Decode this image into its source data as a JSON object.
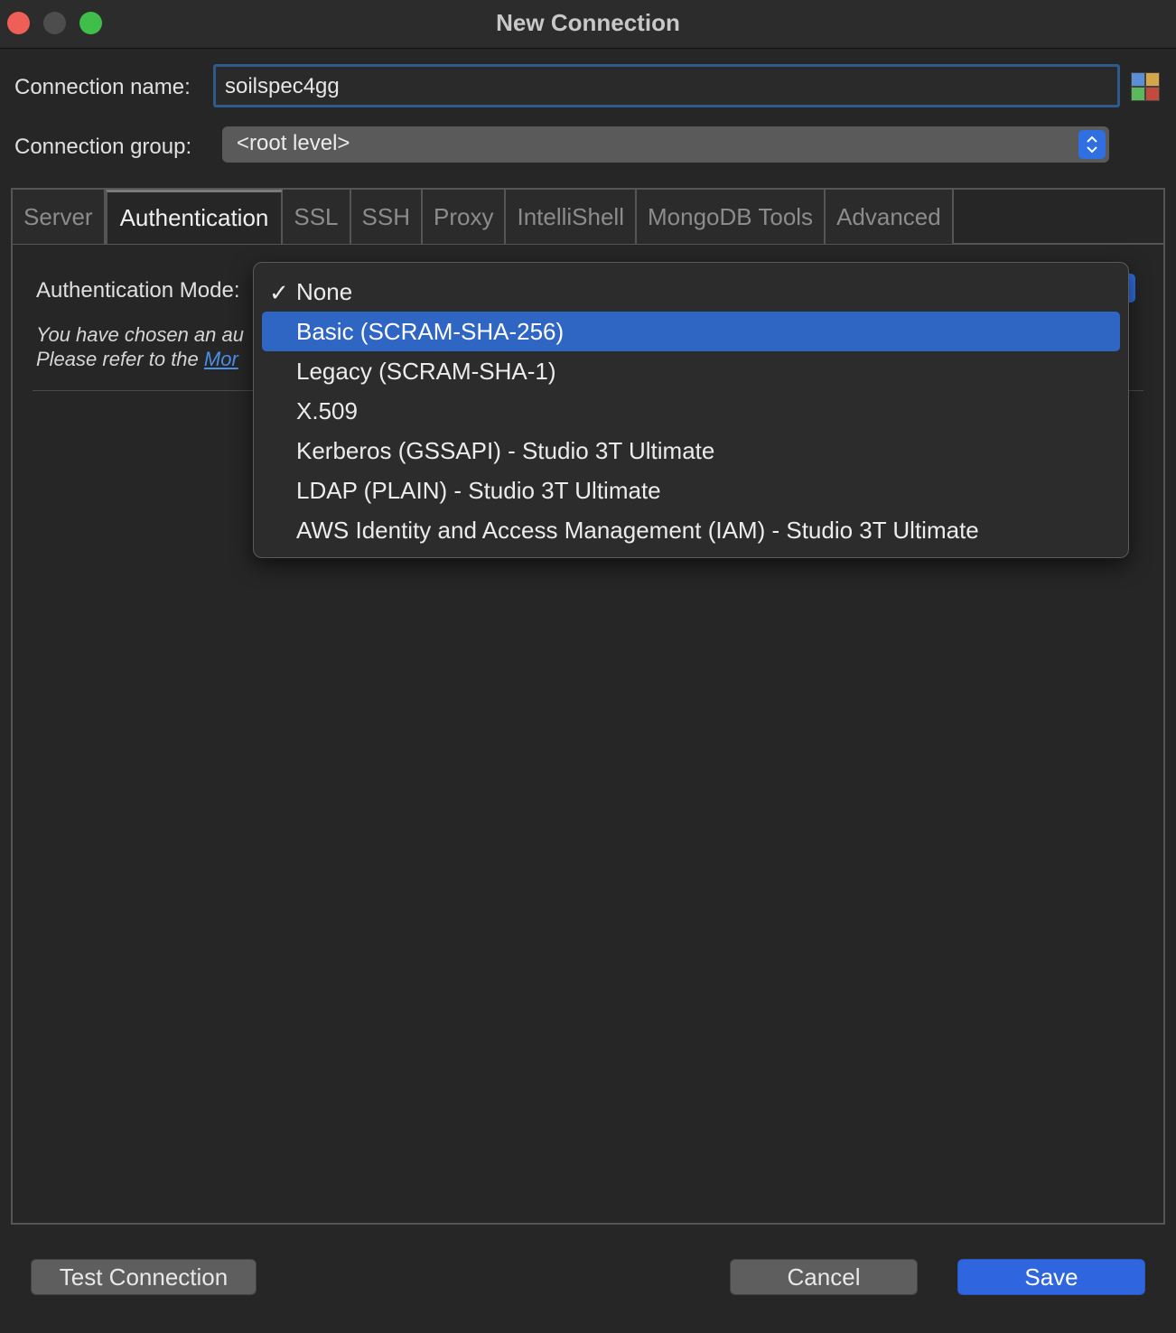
{
  "window": {
    "title": "New Connection"
  },
  "form": {
    "connection_name_label": "Connection name:",
    "connection_name_value": "soilspec4gg",
    "connection_group_label": "Connection group:",
    "connection_group_value": "<root level>"
  },
  "tabs": [
    {
      "label": "Server"
    },
    {
      "label": "Authentication"
    },
    {
      "label": "SSL"
    },
    {
      "label": "SSH"
    },
    {
      "label": "Proxy"
    },
    {
      "label": "IntelliShell"
    },
    {
      "label": "MongoDB Tools"
    },
    {
      "label": "Advanced"
    }
  ],
  "auth": {
    "mode_label": "Authentication Mode:",
    "note_line1": "You have chosen an au",
    "note_line2_prefix": "Please refer to the ",
    "note_link": "Mor"
  },
  "dropdown": {
    "check_glyph": "✓",
    "options": [
      {
        "label": "None"
      },
      {
        "label": "Basic (SCRAM-SHA-256)"
      },
      {
        "label": "Legacy (SCRAM-SHA-1)"
      },
      {
        "label": "X.509"
      },
      {
        "label": "Kerberos (GSSAPI) - Studio 3T Ultimate"
      },
      {
        "label": "LDAP (PLAIN) - Studio 3T Ultimate"
      },
      {
        "label": "AWS Identity and Access Management (IAM) - Studio 3T Ultimate"
      }
    ]
  },
  "buttons": {
    "test": "Test Connection",
    "cancel": "Cancel",
    "save": "Save"
  },
  "colors": {
    "accent": "#2f66e0",
    "highlight": "#2f66c4",
    "close": "#ee5f57",
    "maximize": "#3fbf4a",
    "link": "#4a8fe8"
  },
  "icons": {
    "color_swatch": "color-picker-icon",
    "stepper": "updown-chevron-icon",
    "check": "checkmark-icon"
  }
}
